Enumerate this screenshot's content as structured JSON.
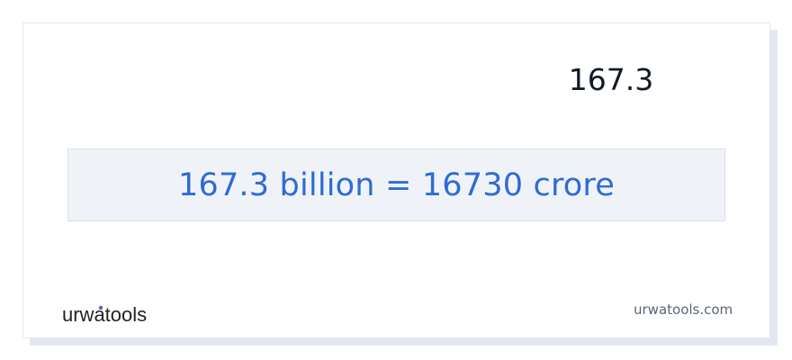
{
  "converter": {
    "input_value": "167.3",
    "result_text": "167.3 billion = 16730 crore"
  },
  "footer": {
    "logo_text": "urwatools",
    "site_url": "urwatools.com"
  },
  "colors": {
    "result_text": "#2f6bd3",
    "result_background": "#eff3f8",
    "logo_text": "#222222",
    "logo_accent": "#6a5acd",
    "url_text": "#5a6577"
  },
  "icons": {
    "logo": "urwatools-logo"
  }
}
